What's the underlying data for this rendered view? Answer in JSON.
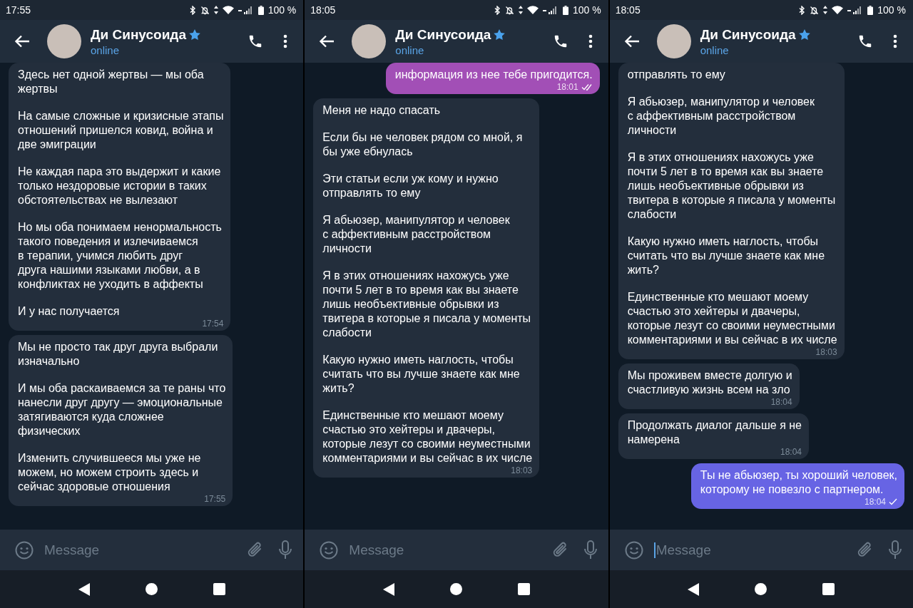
{
  "screens": [
    {
      "status_bar": {
        "time": "17:55",
        "battery": "100 %"
      },
      "chat": {
        "name": "Ди Синусоида",
        "premium": true,
        "status": "online"
      },
      "messages": [
        {
          "outgoing": false,
          "paragraphs": [
            "Здесь нет одной жертвы — мы оба\nжертвы",
            "На самые сложные и кризисные этапы\nотношений пришелся ковид, война и\nдве эмиграции",
            "Не каждая пара это выдержит и какие\nтолько нездоровые истории в таких\nобстоятельствах не вылезают",
            "Но мы оба понимаем ненормальность\nтакого поведения и излечиваемся\nв терапии, учимся любить друг\nдруга нашими языками любви, а в\nконфликтах не уходить в аффекты",
            "И у нас получается"
          ],
          "time": "17:54"
        },
        {
          "outgoing": false,
          "paragraphs": [
            "Мы не просто так друг друга выбрали\nизначально",
            "И мы оба раскаиваемся за те раны что\nнанесли друг другу — эмоциональные\nзатягиваются куда сложнее\nфизических",
            "Изменить случившееся мы уже не\nможем, но можем строить здесь и\nсейчас здоровые отношения"
          ],
          "time": "17:55"
        }
      ],
      "input": {
        "placeholder": "Message",
        "focused": false
      }
    },
    {
      "status_bar": {
        "time": "18:05",
        "battery": "100 %"
      },
      "chat": {
        "name": "Ди Синусоида",
        "premium": true,
        "status": "online"
      },
      "messages": [
        {
          "outgoing": true,
          "color": "#a24fb6",
          "read": true,
          "paragraphs": [
            "информация из нее тебе пригодится."
          ],
          "time": "18:01"
        },
        {
          "outgoing": false,
          "paragraphs": [
            "Меня не надо спасать",
            "Если бы не человек рядом со мной, я\nбы уже ебнулась",
            "Эти статьи если уж кому и нужно\nотправлять то ему",
            "Я абьюзер, манипулятор и человек\nс аффективным расстройством\nличности",
            "Я в этих отношениях нахожусь уже\nпочти 5 лет в то время как вы знаете\nлишь необъективные обрывки из\nтвитера в которые я писала у моменты\nслабости",
            "Какую нужно иметь наглость, чтобы\nсчитать что вы лучше знаете как мне\nжить?",
            "Единственные кто мешают моему\nсчастью это хейтеры и двачеры,\nкоторые лезут со своими неуместными\nкомментариями и вы сейчас в их числе"
          ],
          "time": "18:03"
        }
      ],
      "input": {
        "placeholder": "Message",
        "focused": false
      }
    },
    {
      "status_bar": {
        "time": "18:05",
        "battery": "100 %"
      },
      "chat": {
        "name": "Ди Синусоида",
        "premium": true,
        "status": "online"
      },
      "messages": [
        {
          "outgoing": false,
          "paragraphs": [
            "отправлять то ему",
            "Я абьюзер, манипулятор и человек\nс аффективным расстройством\nличности",
            "Я в этих отношениях нахожусь уже\nпочти 5 лет в то время как вы знаете\nлишь необъективные обрывки из\nтвитера в которые я писала у моменты\nслабости",
            "Какую нужно иметь наглость, чтобы\nсчитать что вы лучше знаете как мне\nжить?",
            "Единственные кто мешают моему\nсчастью это хейтеры и двачеры,\nкоторые лезут со своими неуместными\nкомментариями и вы сейчас в их числе"
          ],
          "time": "18:03"
        },
        {
          "outgoing": false,
          "paragraphs": [
            "Мы проживем вместе долгую и\nсчастливую жизнь всем на зло"
          ],
          "time": "18:04"
        },
        {
          "outgoing": false,
          "paragraphs": [
            "Продолжать диалог дальше я не\nнамерена"
          ],
          "time": "18:04"
        },
        {
          "outgoing": true,
          "color": "#6764e4",
          "read": false,
          "paragraphs": [
            "Ты не абьюзер, ты хороший человек,\nкоторому не повезло с партнером."
          ],
          "time": "18:04"
        }
      ],
      "input": {
        "placeholder": "Message",
        "focused": true
      }
    }
  ]
}
